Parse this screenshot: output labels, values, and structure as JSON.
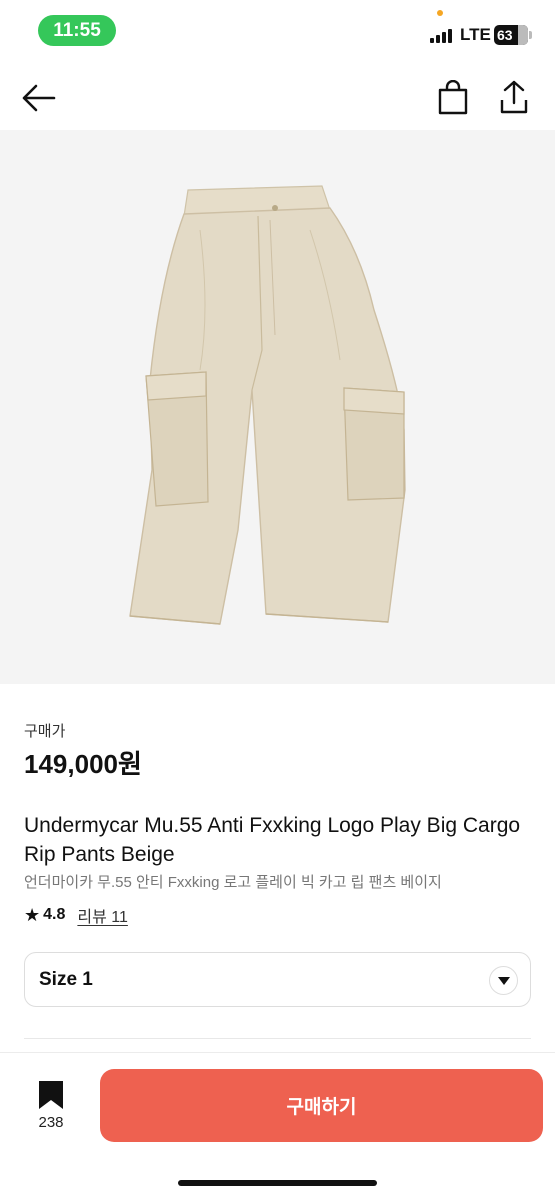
{
  "status_bar": {
    "time": "11:55",
    "network": "LTE",
    "battery": "63"
  },
  "nav": {
    "back_icon": "arrow-left-icon",
    "cart_icon": "shopping-bag-icon",
    "share_icon": "share-icon"
  },
  "product": {
    "image_icon": "cargo-pants-image",
    "price_label": "구매가",
    "price": "149,000원",
    "title": "Undermycar Mu.55 Anti Fxxking Logo Play Big Cargo Rip Pants Beige",
    "subtitle": "언더마이카 무.55 안티 Fxxking 로고 플레이 빅 카고 립 팬츠 베이지",
    "rating": "4.8",
    "review_link": "리뷰 11"
  },
  "size_selector": {
    "label": "Size 1",
    "icon": "chevron-down-icon"
  },
  "footer": {
    "bookmark_count": "238",
    "buy_label": "구매하기"
  },
  "colors": {
    "accent": "#ee6150",
    "status_pill": "#35c75a",
    "image_bg": "#f4f4f4",
    "pants": "#e3dac6"
  }
}
